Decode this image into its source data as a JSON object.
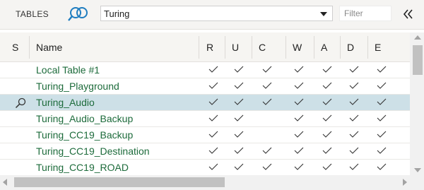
{
  "toolbar": {
    "title": "TABLES",
    "search_icon": "binoculars-icon",
    "table_select": {
      "value": "Turing"
    },
    "filter": {
      "placeholder": "Filter",
      "value": ""
    },
    "collapse_icon": "double-chevron-left-icon"
  },
  "grid": {
    "columns": [
      "S",
      "Name",
      "R",
      "U",
      "C",
      "W",
      "A",
      "D",
      "E"
    ],
    "check_glyph": "checkmark-icon",
    "rows": [
      {
        "name": "Local Table #1",
        "s_icon": "",
        "selected": false,
        "perms": {
          "R": true,
          "U": true,
          "C": true,
          "W": true,
          "A": true,
          "D": true,
          "E": true
        }
      },
      {
        "name": "Turing_Playground",
        "s_icon": "",
        "selected": false,
        "perms": {
          "R": true,
          "U": true,
          "C": true,
          "W": true,
          "A": true,
          "D": true,
          "E": true
        }
      },
      {
        "name": "Turing_Audio",
        "s_icon": "magnifier-icon",
        "selected": true,
        "perms": {
          "R": true,
          "U": true,
          "C": true,
          "W": true,
          "A": true,
          "D": true,
          "E": true
        }
      },
      {
        "name": "Turing_Audio_Backup",
        "s_icon": "",
        "selected": false,
        "perms": {
          "R": true,
          "U": true,
          "C": false,
          "W": true,
          "A": true,
          "D": true,
          "E": true
        }
      },
      {
        "name": "Turing_CC19_Backup",
        "s_icon": "",
        "selected": false,
        "perms": {
          "R": true,
          "U": true,
          "C": false,
          "W": true,
          "A": true,
          "D": true,
          "E": true
        }
      },
      {
        "name": "Turing_CC19_Destination",
        "s_icon": "",
        "selected": false,
        "perms": {
          "R": true,
          "U": true,
          "C": true,
          "W": true,
          "A": true,
          "D": true,
          "E": true
        }
      },
      {
        "name": "Turing_CC19_ROAD",
        "s_icon": "",
        "selected": false,
        "perms": {
          "R": true,
          "U": true,
          "C": true,
          "W": true,
          "A": true,
          "D": true,
          "E": true
        }
      }
    ]
  },
  "colors": {
    "name_text": "#1d6b3b",
    "selected_row": "#cde0e7",
    "icon_blue": "#1f7dc0"
  }
}
